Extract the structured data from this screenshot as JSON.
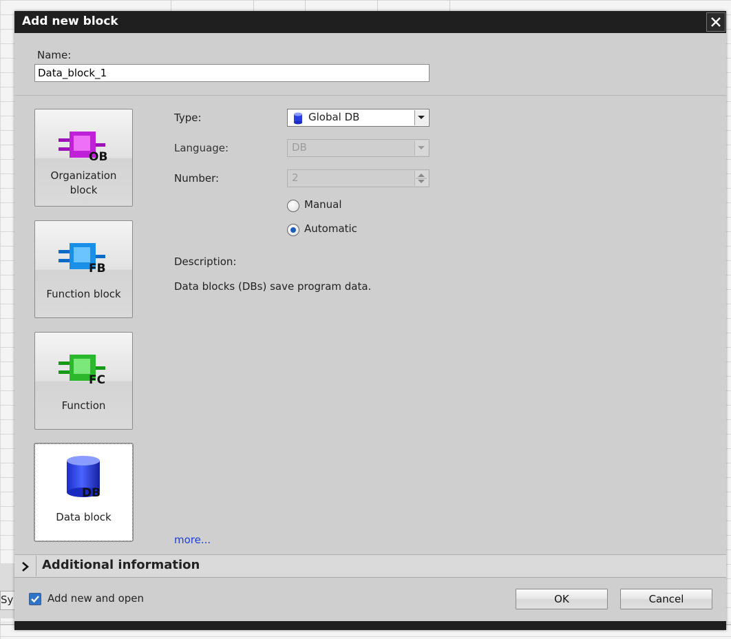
{
  "background": {
    "partial_text": "Sy"
  },
  "dialog": {
    "title": "Add new block",
    "close_label": "✕",
    "name_label": "Name:",
    "name_value": "Data_block_1",
    "block_types": [
      {
        "label_line1": "Organization",
        "label_line2": "block",
        "badge": "OB",
        "color": "#c020d8"
      },
      {
        "label_line1": "Function block",
        "label_line2": "",
        "badge": "FB",
        "color": "#1a8fe8"
      },
      {
        "label_line1": "Function",
        "label_line2": "",
        "badge": "FC",
        "color": "#2cb82c"
      },
      {
        "label_line1": "Data block",
        "label_line2": "",
        "badge": "DB",
        "color": "#2a3ee0"
      }
    ],
    "selected_block": "Data block",
    "form": {
      "type_label": "Type:",
      "type_value": "Global DB",
      "language_label": "Language:",
      "language_value": "DB",
      "number_label": "Number:",
      "number_value": "2",
      "radio_manual": "Manual",
      "radio_automatic": "Automatic",
      "selected_radio": "Automatic"
    },
    "description_title": "Description:",
    "description_text": "Data blocks (DBs) save program data.",
    "more_link": "more...",
    "additional_info": "Additional information",
    "checkbox_label": "Add new and open",
    "checkbox_checked": true,
    "ok_label": "OK",
    "cancel_label": "Cancel"
  }
}
